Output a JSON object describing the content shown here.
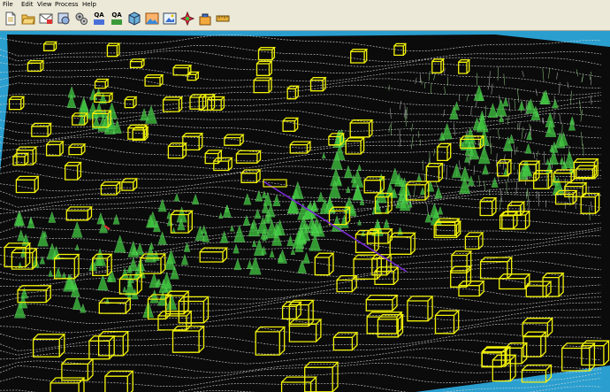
{
  "menu": {
    "file": "File",
    "edit": "Edit",
    "view": "View",
    "process": "Process",
    "help": "Help"
  },
  "toolbar": {
    "buttons": [
      {
        "name": "new-document-button",
        "icon": "page-icon"
      },
      {
        "name": "open-folder-button",
        "icon": "folder-icon"
      },
      {
        "name": "save-button",
        "icon": "envelope-icon"
      },
      {
        "name": "layer-button",
        "icon": "layers-icon"
      },
      {
        "name": "settings-button",
        "icon": "gears-icon"
      },
      {
        "name": "qa-check-button",
        "icon": "qa-icon",
        "label": "QA"
      },
      {
        "name": "qa-report-button",
        "icon": "qa-icon",
        "label": "QA"
      },
      {
        "name": "building-model-button",
        "icon": "cube-icon"
      },
      {
        "name": "terrain-button",
        "icon": "landscape-icon"
      },
      {
        "name": "image-view-button",
        "icon": "picture-icon"
      },
      {
        "name": "color-map-button",
        "icon": "palette-icon"
      },
      {
        "name": "export-button",
        "icon": "package-icon"
      },
      {
        "name": "measure-button",
        "icon": "ruler-icon"
      }
    ]
  },
  "scene": {
    "sky_color": "#2a9fcf",
    "ground_color": "#0b0b0b",
    "contour_color": "#d8d8d8",
    "building_color": "#f2f20a",
    "vegetation_color": "#44e044",
    "profile_line_color": "#7a2ad8"
  }
}
